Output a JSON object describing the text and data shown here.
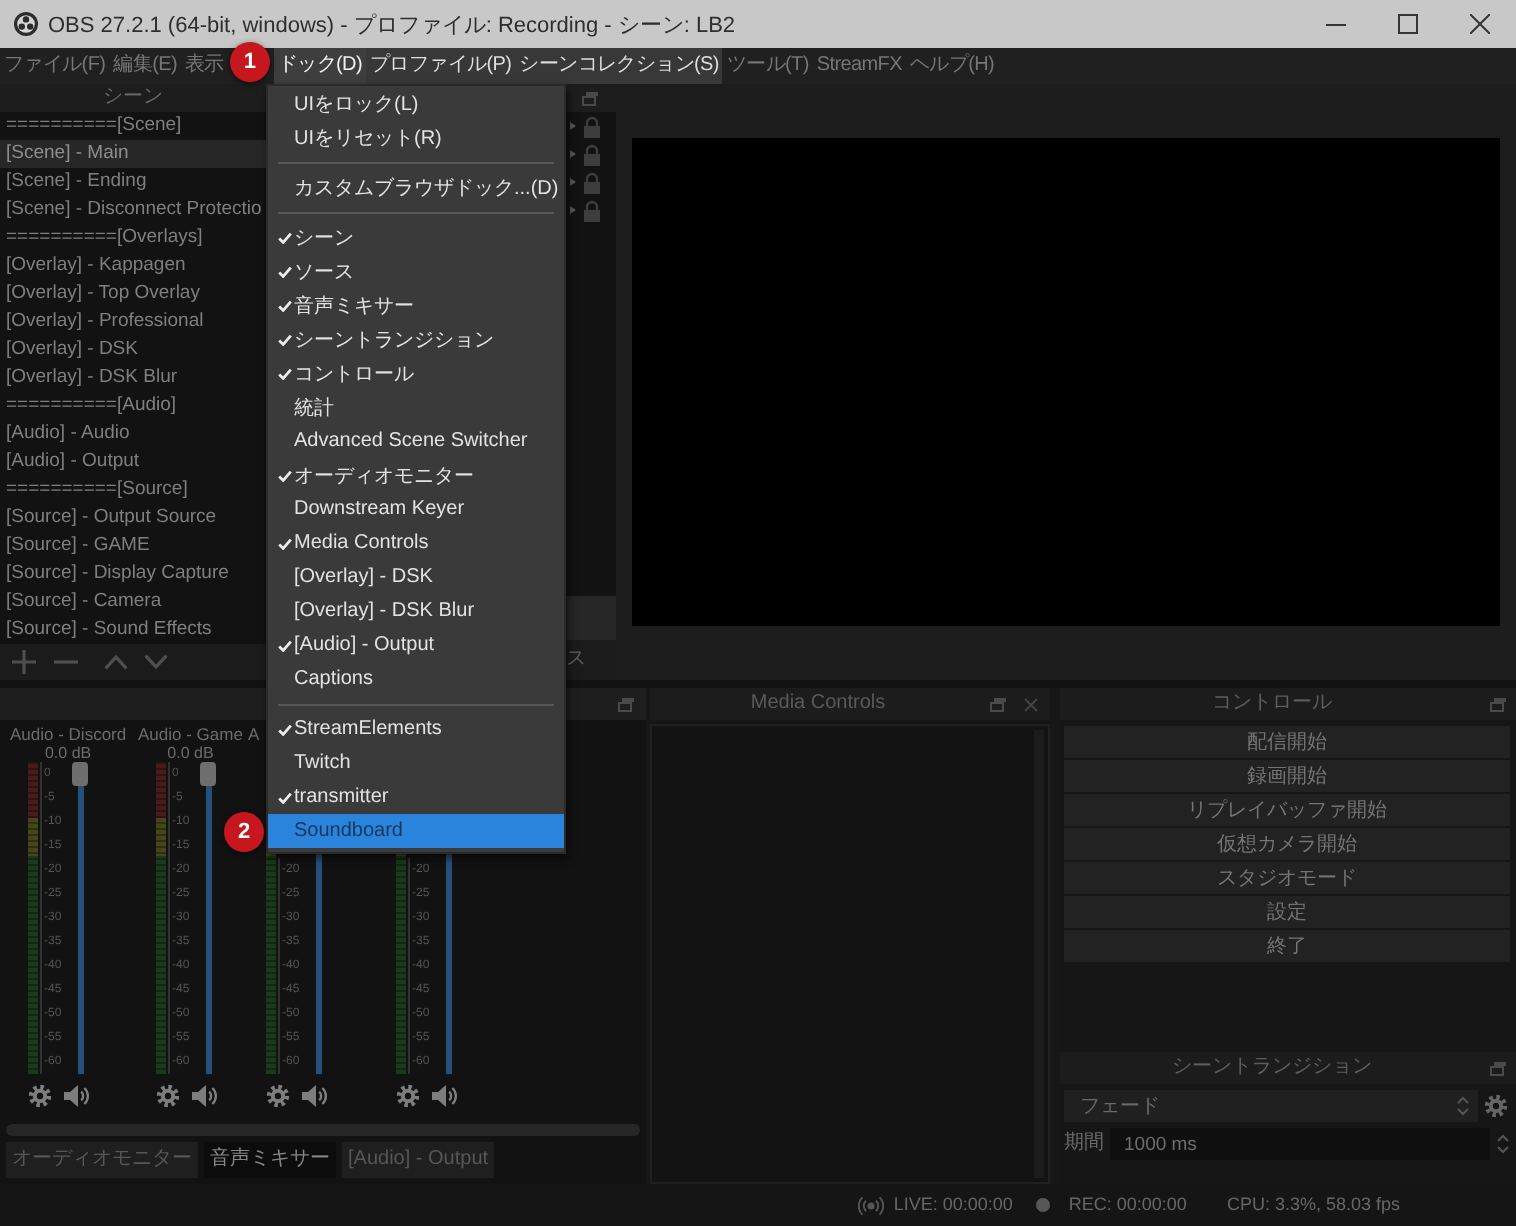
{
  "window": {
    "title": "OBS 27.2.1 (64-bit, windows) - プロファイル: Recording - シーン: LB2"
  },
  "menu_bar": [
    {
      "label": "ファイル(F)",
      "selected": false,
      "highlighted": false
    },
    {
      "label": "編集(E)",
      "selected": false,
      "highlighted": false
    },
    {
      "label": "表示",
      "selected": false,
      "highlighted": false
    },
    {
      "label": "ドック(D)",
      "selected": true,
      "highlighted": true,
      "step_badge": "1"
    },
    {
      "label": "プロファイル(P)",
      "selected": false,
      "highlighted": true
    },
    {
      "label": "シーンコレクション(S)",
      "selected": false,
      "highlighted": true
    },
    {
      "label": "ツール(T)",
      "selected": false,
      "highlighted": false
    },
    {
      "label": "StreamFX",
      "selected": false,
      "highlighted": false
    },
    {
      "label": "ヘルプ(H)",
      "selected": false,
      "highlighted": false
    }
  ],
  "dock_menu": {
    "items": [
      {
        "kind": "action",
        "label": "UIをロック(L)",
        "selected": false
      },
      {
        "kind": "action",
        "label": "UIをリセット(R)",
        "selected": false
      },
      {
        "kind": "separator"
      },
      {
        "kind": "action",
        "label": "カスタムブラウザドック...(D)",
        "selected": false
      },
      {
        "kind": "separator"
      },
      {
        "kind": "check",
        "label": "シーン",
        "checked": true,
        "selected": false
      },
      {
        "kind": "check",
        "label": "ソース",
        "checked": true,
        "selected": false
      },
      {
        "kind": "check",
        "label": "音声ミキサー",
        "checked": true,
        "selected": false
      },
      {
        "kind": "check",
        "label": "シーントランジション",
        "checked": true,
        "selected": false
      },
      {
        "kind": "check",
        "label": "コントロール",
        "checked": true,
        "selected": false
      },
      {
        "kind": "check",
        "label": "統計",
        "checked": false,
        "selected": false
      },
      {
        "kind": "check",
        "label": "Advanced Scene Switcher",
        "checked": false,
        "selected": false
      },
      {
        "kind": "check",
        "label": "オーディオモニター",
        "checked": true,
        "selected": false
      },
      {
        "kind": "check",
        "label": "Downstream Keyer",
        "checked": false,
        "selected": false
      },
      {
        "kind": "check",
        "label": "Media Controls",
        "checked": true,
        "selected": false
      },
      {
        "kind": "check",
        "label": "[Overlay] - DSK",
        "checked": false,
        "selected": false
      },
      {
        "kind": "check",
        "label": "[Overlay] - DSK Blur",
        "checked": false,
        "selected": false
      },
      {
        "kind": "check",
        "label": "[Audio] - Output",
        "checked": true,
        "selected": false
      },
      {
        "kind": "check",
        "label": "Captions",
        "checked": false,
        "selected": false
      },
      {
        "kind": "separator"
      },
      {
        "kind": "check",
        "label": "StreamElements",
        "checked": true,
        "selected": false
      },
      {
        "kind": "check",
        "label": "Twitch",
        "checked": false,
        "selected": false
      },
      {
        "kind": "check",
        "label": "transmitter",
        "checked": true,
        "selected": false
      },
      {
        "kind": "check",
        "label": "Soundboard",
        "checked": false,
        "selected": true,
        "step_badge": "2"
      }
    ]
  },
  "scenes": {
    "title": "シーン",
    "items": [
      {
        "label": "==========[Scene]",
        "selected": false
      },
      {
        "label": "[Scene] - Main",
        "selected": true
      },
      {
        "label": "[Scene] - Ending",
        "selected": false
      },
      {
        "label": "[Scene] - Disconnect Protectio",
        "selected": false
      },
      {
        "label": "==========[Overlays]",
        "selected": false
      },
      {
        "label": "[Overlay] - Kappagen",
        "selected": false
      },
      {
        "label": "[Overlay] - Top Overlay",
        "selected": false
      },
      {
        "label": "[Overlay] - Professional",
        "selected": false
      },
      {
        "label": "[Overlay] - DSK",
        "selected": false
      },
      {
        "label": "[Overlay] - DSK Blur",
        "selected": false
      },
      {
        "label": "==========[Audio]",
        "selected": false
      },
      {
        "label": "[Audio] - Audio",
        "selected": false
      },
      {
        "label": "[Audio] - Output",
        "selected": false
      },
      {
        "label": "==========[Source]",
        "selected": false
      },
      {
        "label": "[Source] - Output Source",
        "selected": false
      },
      {
        "label": "[Source] - GAME",
        "selected": false
      },
      {
        "label": "[Source] - Display Capture",
        "selected": false
      },
      {
        "label": "[Source] - Camera",
        "selected": false
      },
      {
        "label": "[Source] - Sound Effects",
        "selected": false
      }
    ]
  },
  "dock_2": {
    "tab": "ス"
  },
  "audio_mixer": {
    "channels": [
      {
        "name": "Audio - Discord",
        "volume": "0.0 dB",
        "level": 1,
        "scale": [
          "0",
          "-5",
          "-10",
          "-15",
          "-20",
          "-25",
          "-30",
          "-35",
          "-40",
          "-45",
          "-50",
          "-55",
          "-60"
        ]
      },
      {
        "name": "Audio - Game",
        "volume": "0.0 dB",
        "level": 1,
        "scale": [
          "0",
          "-5",
          "-10",
          "-15",
          "-20",
          "-25",
          "-30",
          "-35",
          "-40",
          "-45",
          "-50",
          "-55",
          "-60"
        ]
      },
      {
        "name": "A",
        "level": 1,
        "scale": [
          "-20",
          "-25",
          "-30",
          "-35",
          "-40",
          "-45",
          "-50",
          "-55",
          "-60"
        ]
      },
      {
        "level": 1,
        "scale": [
          "-20",
          "-25",
          "-30",
          "-35",
          "-40",
          "-45",
          "-50",
          "-55",
          "-60"
        ]
      }
    ],
    "tabs": [
      {
        "label": "オーディオモニター",
        "selected": false
      },
      {
        "label": "音声ミキサー",
        "selected": true
      },
      {
        "label": "[Audio] - Output",
        "selected": false
      }
    ]
  },
  "media_controls": {
    "title": "Media Controls"
  },
  "controls": {
    "title": "コントロール",
    "buttons": [
      "配信開始",
      "録画開始",
      "リプレイバッファ開始",
      "仮想カメラ開始",
      "スタジオモード",
      "設定",
      "終了"
    ]
  },
  "scene_transitions": {
    "title": "シーントランジション",
    "transition": "フェード",
    "duration_label": "期間",
    "duration": "1000 ms"
  },
  "status_bar": {
    "live": "LIVE: 00:00:00",
    "rec": "REC: 00:00:00",
    "cpu": "CPU: 3.3%, 58.03 fps"
  }
}
